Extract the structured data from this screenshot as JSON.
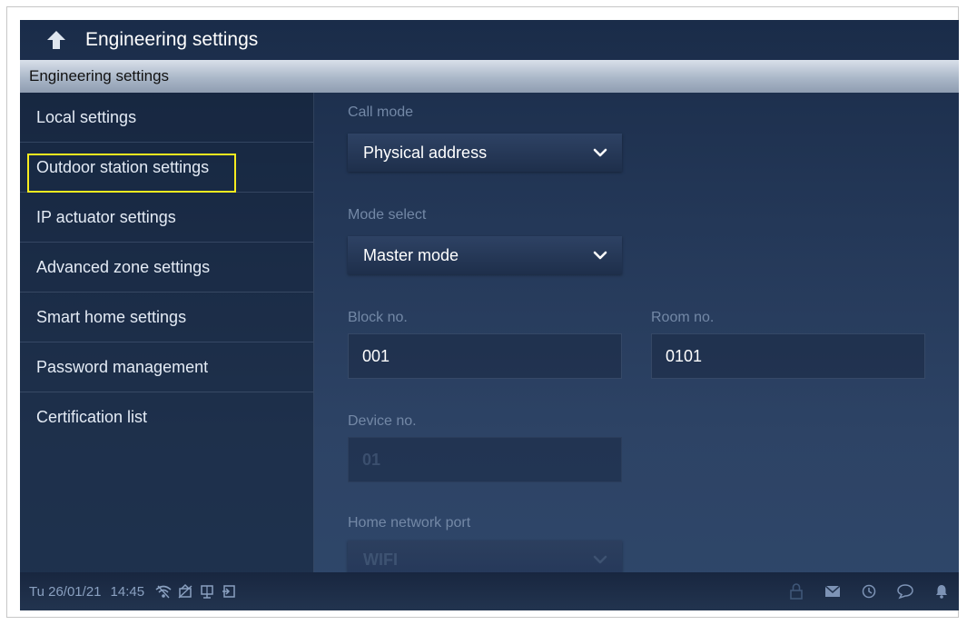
{
  "header": {
    "title": "Engineering settings"
  },
  "section": {
    "title": "Engineering settings"
  },
  "sidebar": {
    "items": [
      {
        "label": "Local settings"
      },
      {
        "label": "Outdoor station settings"
      },
      {
        "label": "IP actuator settings"
      },
      {
        "label": "Advanced zone settings"
      },
      {
        "label": "Smart home settings"
      },
      {
        "label": "Password management"
      },
      {
        "label": "Certification list"
      }
    ],
    "highlighted": "Outdoor station settings"
  },
  "form": {
    "call_mode": {
      "label": "Call mode",
      "value": "Physical address"
    },
    "mode_select": {
      "label": "Mode select",
      "value": "Master mode"
    },
    "block_no": {
      "label": "Block no.",
      "value": "001"
    },
    "room_no": {
      "label": "Room no.",
      "value": "0101"
    },
    "device_no": {
      "label": "Device no.",
      "value": "01"
    },
    "home_network_port": {
      "label": "Home network port",
      "value": "WIFI"
    }
  },
  "status": {
    "date": "Tu 26/01/21",
    "time": "14:45",
    "left_icons": [
      "wifi-icon",
      "no-disturb-icon",
      "monitor-icon",
      "exit-icon"
    ],
    "right_icons": [
      "lock-icon",
      "mail-icon",
      "history-icon",
      "chat-icon",
      "bell-icon"
    ]
  },
  "colors": {
    "highlight_border": "#f6ec1f",
    "screen_bg": "#243858",
    "label_text": "#7388a6"
  }
}
